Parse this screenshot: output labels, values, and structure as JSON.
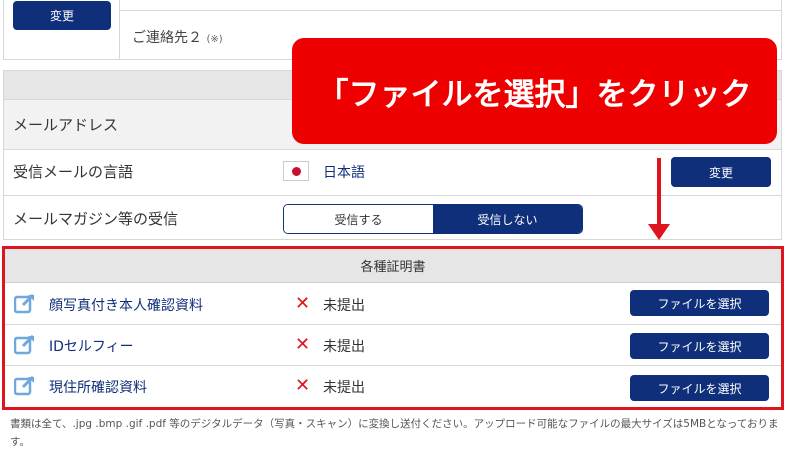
{
  "top": {
    "change_button": "変更",
    "contact2_label": "ご連絡先２",
    "contact2_note": "(※)"
  },
  "settings": {
    "email_label": "メールアドレス",
    "language_label": "受信メールの言語",
    "language_value": "日本語",
    "language_change_button": "変更",
    "magazine_label": "メールマガジン等の受信",
    "magazine_options": [
      "受信する",
      "受信しない"
    ],
    "magazine_selected": "受信しない"
  },
  "certificates": {
    "header": "各種証明書",
    "items": [
      {
        "name": "顔写真付き本人確認資料",
        "status": "未提出",
        "button": "ファイルを選択"
      },
      {
        "name": "IDセルフィー",
        "status": "未提出",
        "button": "ファイルを選択"
      },
      {
        "name": "現住所確認資料",
        "status": "未提出",
        "button": "ファイルを選択"
      }
    ],
    "status_icon": "x-icon"
  },
  "note": "書類は全て、.jpg .bmp .gif .pdf 等のデジタルデータ（写真・スキャン）に変換し送付ください。アップロード可能なファイルの最大サイズは5MBとなっております。",
  "callout": {
    "text": "「ファイルを選択」をクリック"
  },
  "colors": {
    "navy": "#0f2f7a",
    "red": "#e0141e",
    "callout_bg": "#ee0000"
  }
}
